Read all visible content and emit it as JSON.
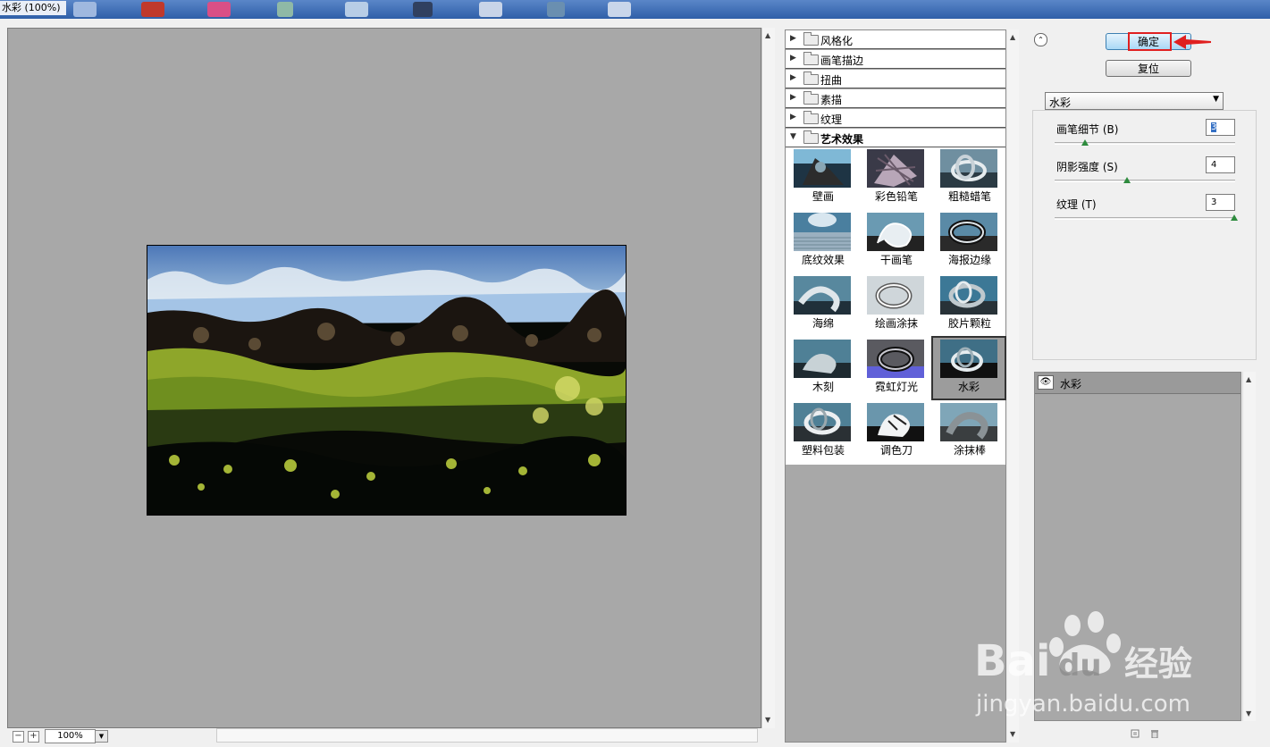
{
  "window": {
    "title": "水彩 (100%)"
  },
  "preview": {
    "zoom": "100%"
  },
  "categories": [
    {
      "label": "风格化",
      "open": false
    },
    {
      "label": "画笔描边",
      "open": false
    },
    {
      "label": "扭曲",
      "open": false
    },
    {
      "label": "素描",
      "open": false
    },
    {
      "label": "纹理",
      "open": false
    },
    {
      "label": "艺术效果",
      "open": true
    }
  ],
  "filters": [
    {
      "label": "壁画"
    },
    {
      "label": "彩色铅笔"
    },
    {
      "label": "粗糙蜡笔"
    },
    {
      "label": "底纹效果"
    },
    {
      "label": "干画笔"
    },
    {
      "label": "海报边缘"
    },
    {
      "label": "海绵"
    },
    {
      "label": "绘画涂抹"
    },
    {
      "label": "胶片颗粒"
    },
    {
      "label": "木刻"
    },
    {
      "label": "霓虹灯光"
    },
    {
      "label": "水彩"
    },
    {
      "label": "塑料包装"
    },
    {
      "label": "调色刀"
    },
    {
      "label": "涂抹棒"
    }
  ],
  "buttons": {
    "ok": "确定",
    "reset": "复位"
  },
  "filter_select": {
    "value": "水彩"
  },
  "params": [
    {
      "label": "画笔细节 (B)",
      "value": "3",
      "level_fraction": 0.14
    },
    {
      "label": "阴影强度 (S)",
      "value": "4",
      "level_fraction": 0.4
    },
    {
      "label": "纹理 (T)",
      "value": "3",
      "level_fraction": 1.0
    }
  ],
  "layers": [
    {
      "label": "水彩"
    }
  ],
  "watermark": {
    "brand": "Baidu经验",
    "url": "jingyan.baidu.com"
  },
  "colors": {
    "preview_bg": "#a8a8a8",
    "ok_button": "#a9d8f6",
    "highlight": "#e02020",
    "slider_thumb": "#2e8b3e"
  }
}
